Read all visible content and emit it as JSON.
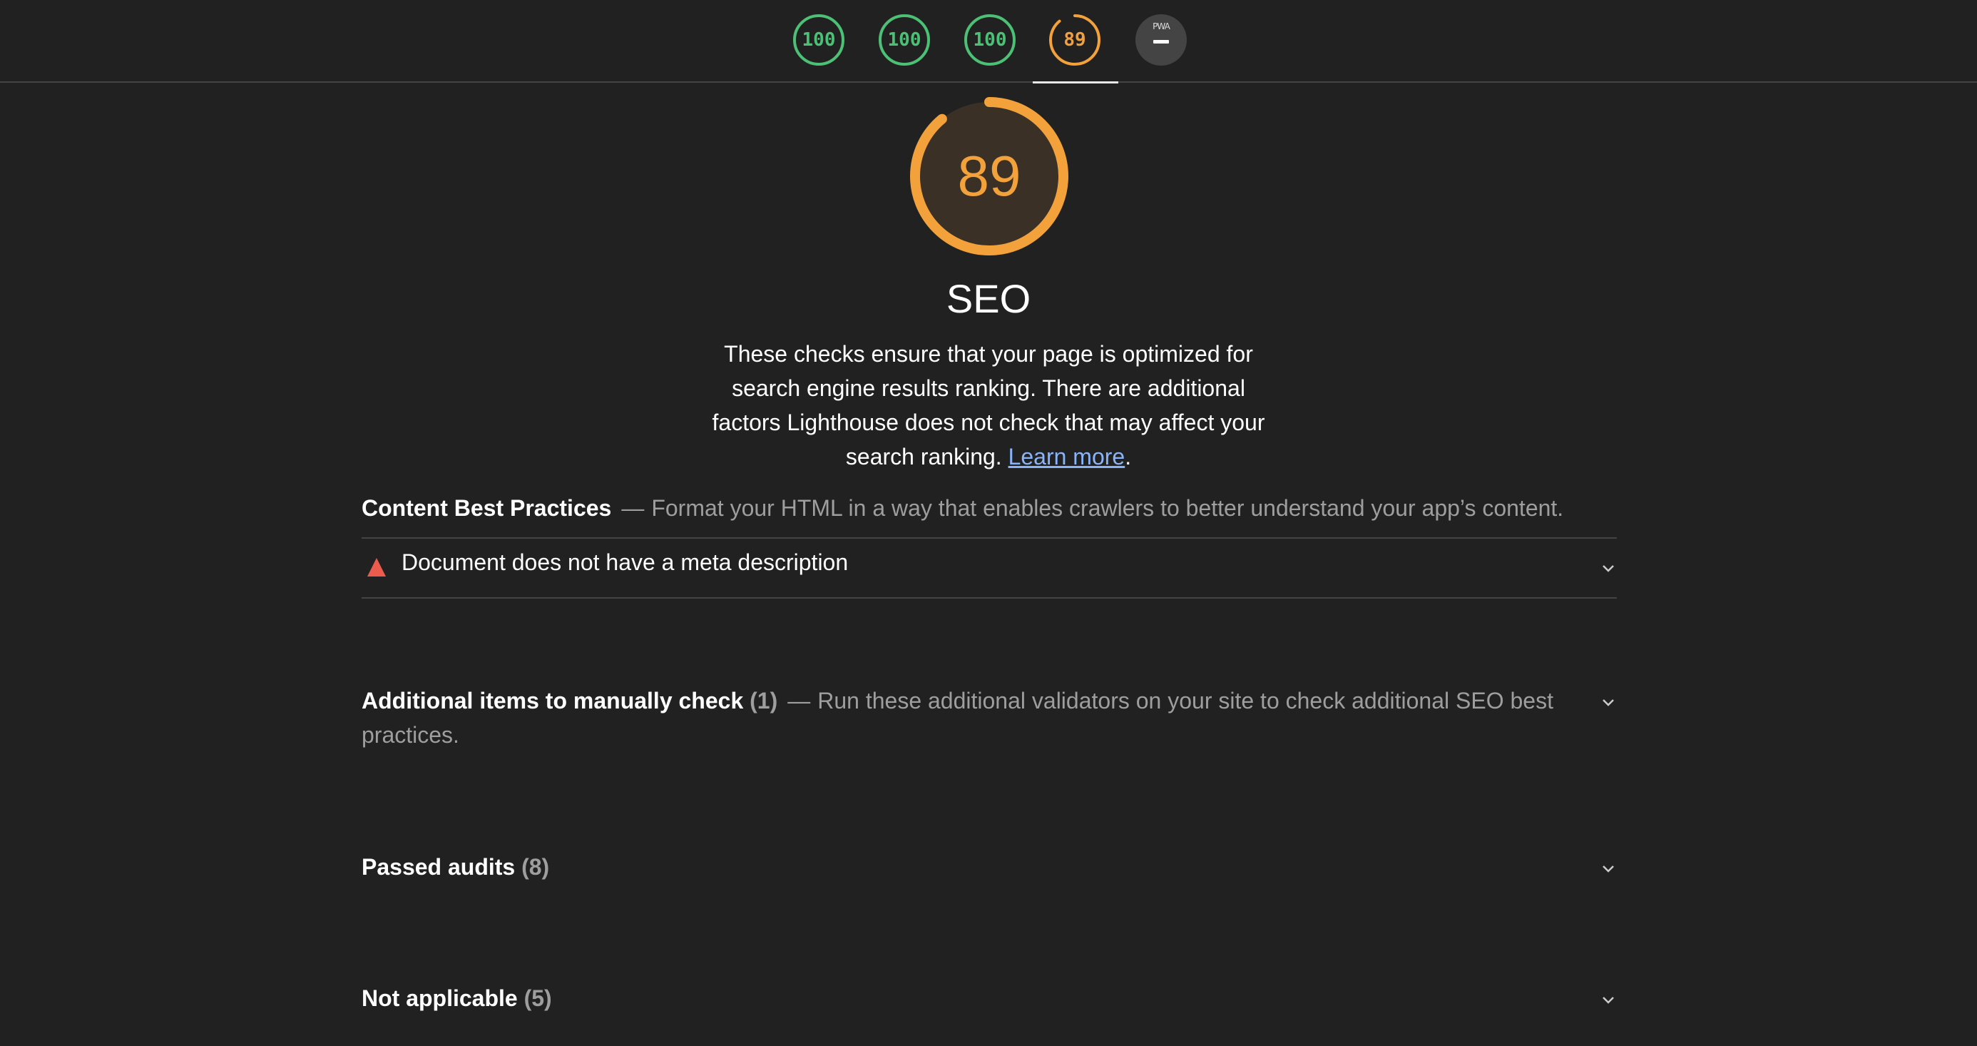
{
  "nav": {
    "scores": [
      {
        "value": "100",
        "score": 1.0,
        "rating": "pass"
      },
      {
        "value": "100",
        "score": 1.0,
        "rating": "pass"
      },
      {
        "value": "100",
        "score": 1.0,
        "rating": "pass"
      },
      {
        "value": "89",
        "score": 0.89,
        "rating": "average"
      }
    ],
    "pwa_label": "PWA"
  },
  "colors": {
    "pass": "#4cc074",
    "average": "#f3a13a",
    "fail": "#eb5b4e",
    "background": "#212121",
    "link": "#8ab4f8"
  },
  "category": {
    "score": "89",
    "score_fraction": 0.89,
    "title": "SEO",
    "description_pre": "These checks ensure that your page is optimized for search engine results ranking. There are additional factors Lighthouse does not check that may affect your search ranking. ",
    "learn_more": "Learn more",
    "description_post": "."
  },
  "groups": {
    "content": {
      "title": "Content Best Practices",
      "dash": "—",
      "description": "Format your HTML in a way that enables crawlers to better understand your app’s content.",
      "audits": [
        {
          "title": "Document does not have a meta description",
          "icon": "fail-triangle-icon"
        }
      ]
    },
    "manual": {
      "title": "Additional items to manually check",
      "count": "(1)",
      "dash": "—",
      "description": "Run these additional validators on your site to check additional SEO best practices."
    },
    "passed": {
      "title": "Passed audits",
      "count": "(8)"
    },
    "notapplicable": {
      "title": "Not applicable",
      "count": "(5)"
    }
  }
}
